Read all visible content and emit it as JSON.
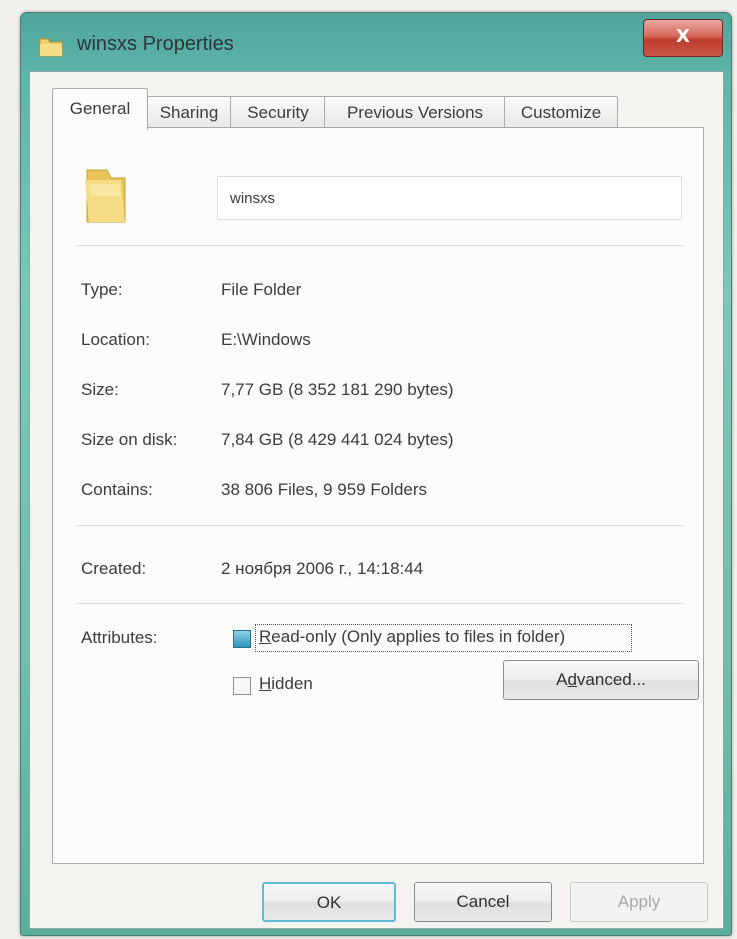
{
  "window": {
    "title": "winsxs Properties",
    "close_label": "X"
  },
  "tabs": [
    {
      "label": "General"
    },
    {
      "label": "Sharing"
    },
    {
      "label": "Security"
    },
    {
      "label": "Previous Versions"
    },
    {
      "label": "Customize"
    }
  ],
  "general": {
    "folder_name": "winsxs",
    "type_label": "Type:",
    "type_value": "File Folder",
    "location_label": "Location:",
    "location_value": "E:\\Windows",
    "size_label": "Size:",
    "size_value": "7,77 GB (8 352 181 290 bytes)",
    "size_on_disk_label": "Size on disk:",
    "size_on_disk_value": "7,84 GB (8 429 441 024 bytes)",
    "contains_label": "Contains:",
    "contains_value": "38 806 Files, 9 959 Folders",
    "created_label": "Created:",
    "created_value": "2 ноября 2006 г., 14:18:44",
    "attributes_label": "Attributes:",
    "readonly_first": "R",
    "readonly_rest": "ead-only (Only applies to files in folder)",
    "readonly_checked": true,
    "hidden_first": "H",
    "hidden_rest": "idden",
    "hidden_checked": false,
    "advanced_a": "A",
    "advanced_d": "d",
    "advanced_rest": "vanced..."
  },
  "buttons": {
    "ok": "OK",
    "cancel": "Cancel",
    "apply": "Apply"
  },
  "colors": {
    "accent": "#5dbbd6",
    "titlebar": "#6fbfab",
    "close": "#c8584a"
  }
}
